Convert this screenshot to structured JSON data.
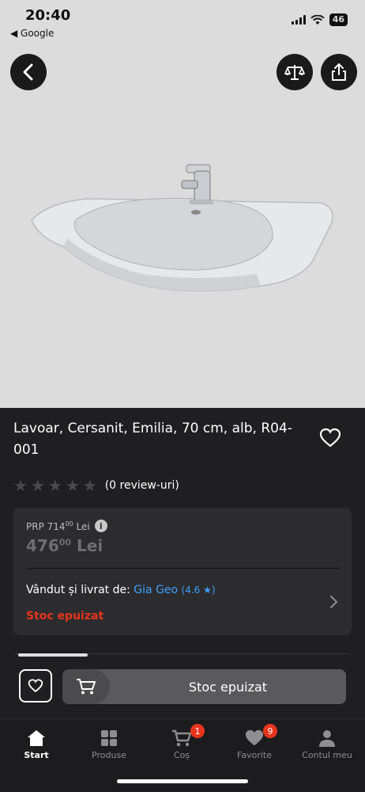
{
  "status_bar": {
    "time": "20:40",
    "back_app": "◀ Google",
    "battery": "46"
  },
  "hero": {
    "back_icon": "chevron-left-icon",
    "compare_icon": "scale-icon",
    "share_icon": "share-icon"
  },
  "product": {
    "title": "Lavoar, Cersanit, Emilia, 70 cm, alb, R04-001",
    "reviews": "(0 review-uri)",
    "rating_stars": 0,
    "prp_label": "PRP",
    "prp_integer": "714",
    "prp_decimals": "00",
    "prp_currency": "Lei",
    "price_integer": "476",
    "price_decimals": "00",
    "price_currency": "Lei",
    "seller_prefix": "Vândut și livrat de:",
    "seller_name": "Gia Geo",
    "seller_rating": "(4.6 ★)",
    "stock_status": "Stoc epuizat"
  },
  "action_bar": {
    "cart_label": "Stoc epuizat"
  },
  "colors": {
    "accent_red": "#e8341c",
    "link_blue": "#3ba0ff",
    "panel_bg": "#1f1f21"
  },
  "bottom_nav": {
    "items": [
      {
        "label": "Start",
        "icon": "home-icon",
        "active": true
      },
      {
        "label": "Produse",
        "icon": "grid-icon"
      },
      {
        "label": "Coș",
        "icon": "cart-icon",
        "badge": "1"
      },
      {
        "label": "Favorite",
        "icon": "heart-icon",
        "badge": "9"
      },
      {
        "label": "Contul meu",
        "icon": "user-icon"
      }
    ]
  }
}
